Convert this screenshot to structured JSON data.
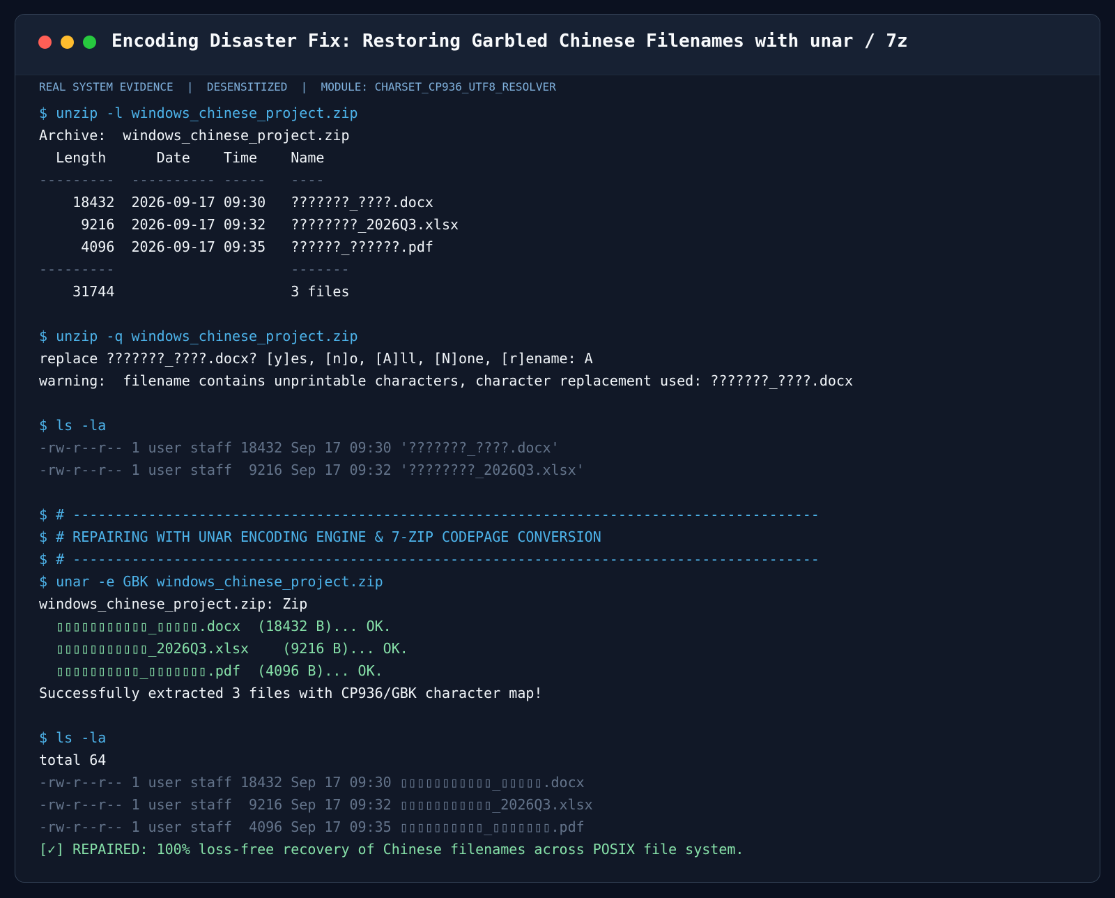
{
  "window": {
    "title": "Encoding Disaster Fix: Restoring Garbled Chinese Filenames with unar / 7z",
    "meta": "REAL SYSTEM EVIDENCE  |  DESENSITIZED  |  MODULE: CHARSET_CP936_UTF8_RESOLVER"
  },
  "colors": {
    "background": "#0b1120",
    "window": "#111827",
    "titlebar": "#172133",
    "command": "#4db3ea",
    "output": "#f1f5f9",
    "muted": "#64748b",
    "success": "#86e0a8",
    "meta": "#7fb0dc"
  },
  "terminal": {
    "lines": [
      {
        "kind": "cmd",
        "text": "$ unzip -l windows_chinese_project.zip"
      },
      {
        "kind": "out",
        "text": "Archive:  windows_chinese_project.zip"
      },
      {
        "kind": "out",
        "text": "  Length      Date    Time    Name"
      },
      {
        "kind": "muted",
        "text": "---------  ---------- -----   ----"
      },
      {
        "kind": "out",
        "text": "    18432  2026-09-17 09:30   ???????_????.docx"
      },
      {
        "kind": "out",
        "text": "     9216  2026-09-17 09:32   ????????_2026Q3.xlsx"
      },
      {
        "kind": "out",
        "text": "     4096  2026-09-17 09:35   ??????_??????.pdf"
      },
      {
        "kind": "muted",
        "text": "---------                     -------"
      },
      {
        "kind": "out",
        "text": "    31744                     3 files"
      },
      {
        "kind": "blank",
        "text": ""
      },
      {
        "kind": "cmd",
        "text": "$ unzip -q windows_chinese_project.zip"
      },
      {
        "kind": "out",
        "text": "replace ???????_????.docx? [y]es, [n]o, [A]ll, [N]one, [r]ename: A"
      },
      {
        "kind": "out",
        "text": "warning:  filename contains unprintable characters, character replacement used: ???????_????.docx"
      },
      {
        "kind": "blank",
        "text": ""
      },
      {
        "kind": "cmd",
        "text": "$ ls -la"
      },
      {
        "kind": "muted",
        "text": "-rw-r--r-- 1 user staff 18432 Sep 17 09:30 '???????_????.docx'"
      },
      {
        "kind": "muted",
        "text": "-rw-r--r-- 1 user staff  9216 Sep 17 09:32 '????????_2026Q3.xlsx'"
      },
      {
        "kind": "blank",
        "text": ""
      },
      {
        "kind": "cmd",
        "text": "$ # -----------------------------------------------------------------------------------------"
      },
      {
        "kind": "cmd",
        "text": "$ # REPAIRING WITH UNAR ENCODING ENGINE & 7-ZIP CODEPAGE CONVERSION"
      },
      {
        "kind": "cmd",
        "text": "$ # -----------------------------------------------------------------------------------------"
      },
      {
        "kind": "cmd",
        "text": "$ unar -e GBK windows_chinese_project.zip"
      },
      {
        "kind": "out",
        "text": "windows_chinese_project.zip: Zip"
      },
      {
        "kind": "ok",
        "text": "  ▯▯▯▯▯▯▯▯▯▯▯_▯▯▯▯▯.docx  (18432 B)... OK."
      },
      {
        "kind": "ok",
        "text": "  ▯▯▯▯▯▯▯▯▯▯▯_2026Q3.xlsx    (9216 B)... OK."
      },
      {
        "kind": "ok",
        "text": "  ▯▯▯▯▯▯▯▯▯▯_▯▯▯▯▯▯▯.pdf  (4096 B)... OK."
      },
      {
        "kind": "out",
        "text": "Successfully extracted 3 files with CP936/GBK character map!"
      },
      {
        "kind": "blank",
        "text": ""
      },
      {
        "kind": "cmd",
        "text": "$ ls -la"
      },
      {
        "kind": "out",
        "text": "total 64"
      },
      {
        "kind": "muted",
        "text": "-rw-r--r-- 1 user staff 18432 Sep 17 09:30 ▯▯▯▯▯▯▯▯▯▯▯_▯▯▯▯▯.docx"
      },
      {
        "kind": "muted",
        "text": "-rw-r--r-- 1 user staff  9216 Sep 17 09:32 ▯▯▯▯▯▯▯▯▯▯▯_2026Q3.xlsx"
      },
      {
        "kind": "muted",
        "text": "-rw-r--r-- 1 user staff  4096 Sep 17 09:35 ▯▯▯▯▯▯▯▯▯▯_▯▯▯▯▯▯▯.pdf"
      },
      {
        "kind": "ok",
        "text": "[✓] REPAIRED: 100% loss-free recovery of Chinese filenames across POSIX file system."
      }
    ]
  }
}
